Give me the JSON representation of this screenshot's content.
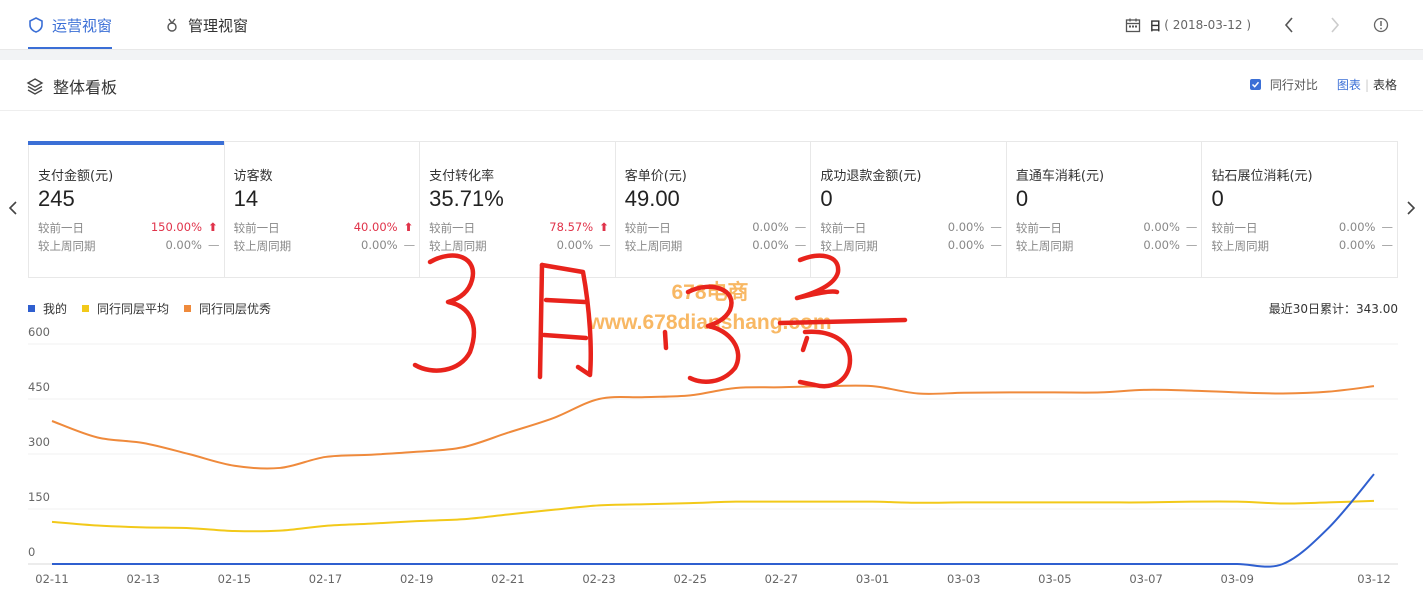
{
  "topnav": {
    "tabs": [
      {
        "label": "运营视窗",
        "active": true
      },
      {
        "label": "管理视窗",
        "active": false
      }
    ],
    "date_label": "日",
    "date_value": "( 2018-03-12 )"
  },
  "panel": {
    "title": "整体看板",
    "compare_label": "同行对比",
    "view_chart": "图表",
    "view_table": "表格"
  },
  "kpis": [
    {
      "name": "支付金额(元)",
      "value": "245",
      "d1_label": "较前一日",
      "d1_value": "150.00%",
      "d1_dir": "up",
      "w_label": "较上周同期",
      "w_value": "0.00%",
      "w_dir": "flat"
    },
    {
      "name": "访客数",
      "value": "14",
      "d1_label": "较前一日",
      "d1_value": "40.00%",
      "d1_dir": "up",
      "w_label": "较上周同期",
      "w_value": "0.00%",
      "w_dir": "flat"
    },
    {
      "name": "支付转化率",
      "value": "35.71%",
      "d1_label": "较前一日",
      "d1_value": "78.57%",
      "d1_dir": "up",
      "w_label": "较上周同期",
      "w_value": "0.00%",
      "w_dir": "flat"
    },
    {
      "name": "客单价(元)",
      "value": "49.00",
      "d1_label": "较前一日",
      "d1_value": "0.00%",
      "d1_dir": "flat",
      "w_label": "较上周同期",
      "w_value": "0.00%",
      "w_dir": "flat"
    },
    {
      "name": "成功退款金额(元)",
      "value": "0",
      "d1_label": "较前一日",
      "d1_value": "0.00%",
      "d1_dir": "flat",
      "w_label": "较上周同期",
      "w_value": "0.00%",
      "w_dir": "flat"
    },
    {
      "name": "直通车消耗(元)",
      "value": "0",
      "d1_label": "较前一日",
      "d1_value": "0.00%",
      "d1_dir": "flat",
      "w_label": "较上周同期",
      "w_value": "0.00%",
      "w_dir": "flat"
    },
    {
      "name": "钻石展位消耗(元)",
      "value": "0",
      "d1_label": "较前一日",
      "d1_value": "0.00%",
      "d1_dir": "flat",
      "w_label": "较上周同期",
      "w_value": "0.00%",
      "w_dir": "flat"
    }
  ],
  "legend": [
    "我的",
    "同行同层平均",
    "同行同层优秀"
  ],
  "summary": "最近30日累计：343.00",
  "overlay": {
    "handwriting": "3月13号",
    "watermark_line1": "678电商",
    "watermark_line2": "www.678dianshang.com"
  },
  "colors": {
    "accent": "#3b6fd6",
    "mine": "#2f5fcf",
    "avg": "#f2c91a",
    "excellent": "#ef8a3c",
    "up": "#e0334a",
    "handwriting": "#e8231c",
    "watermark": "#f5a030"
  },
  "chart_data": {
    "type": "line",
    "x": [
      "02-11",
      "02-12",
      "02-13",
      "02-14",
      "02-15",
      "02-16",
      "02-17",
      "02-18",
      "02-19",
      "02-20",
      "02-21",
      "02-22",
      "02-23",
      "02-24",
      "02-25",
      "02-26",
      "02-27",
      "02-28",
      "03-01",
      "03-02",
      "03-03",
      "03-04",
      "03-05",
      "03-06",
      "03-07",
      "03-08",
      "03-09",
      "03-10",
      "03-11",
      "03-12"
    ],
    "x_tick_labels": [
      "02-11",
      "02-13",
      "02-15",
      "02-17",
      "02-19",
      "02-21",
      "02-23",
      "02-25",
      "02-27",
      "03-01",
      "03-03",
      "03-05",
      "03-07",
      "03-09",
      "03-12"
    ],
    "y_ticks": [
      "600",
      "450",
      "300",
      "150",
      "0"
    ],
    "ylim": [
      0,
      600
    ],
    "series": [
      {
        "name": "我的",
        "values": [
          0,
          0,
          0,
          0,
          0,
          0,
          0,
          0,
          0,
          0,
          0,
          0,
          0,
          0,
          0,
          0,
          0,
          0,
          0,
          0,
          0,
          0,
          0,
          0,
          0,
          0,
          0,
          0,
          98,
          245
        ]
      },
      {
        "name": "同行同层平均",
        "values": [
          115,
          105,
          100,
          98,
          90,
          91,
          104,
          110,
          117,
          122,
          135,
          148,
          160,
          163,
          166,
          170,
          170,
          170,
          170,
          167,
          168,
          168,
          168,
          168,
          168,
          170,
          170,
          165,
          168,
          172
        ]
      },
      {
        "name": "同行同层优秀",
        "values": [
          390,
          345,
          330,
          300,
          268,
          262,
          292,
          298,
          306,
          318,
          358,
          398,
          450,
          455,
          460,
          480,
          482,
          485,
          485,
          465,
          467,
          468,
          468,
          468,
          475,
          473,
          468,
          465,
          470,
          485
        ]
      }
    ],
    "grid": true,
    "legend_position": "top-left"
  }
}
